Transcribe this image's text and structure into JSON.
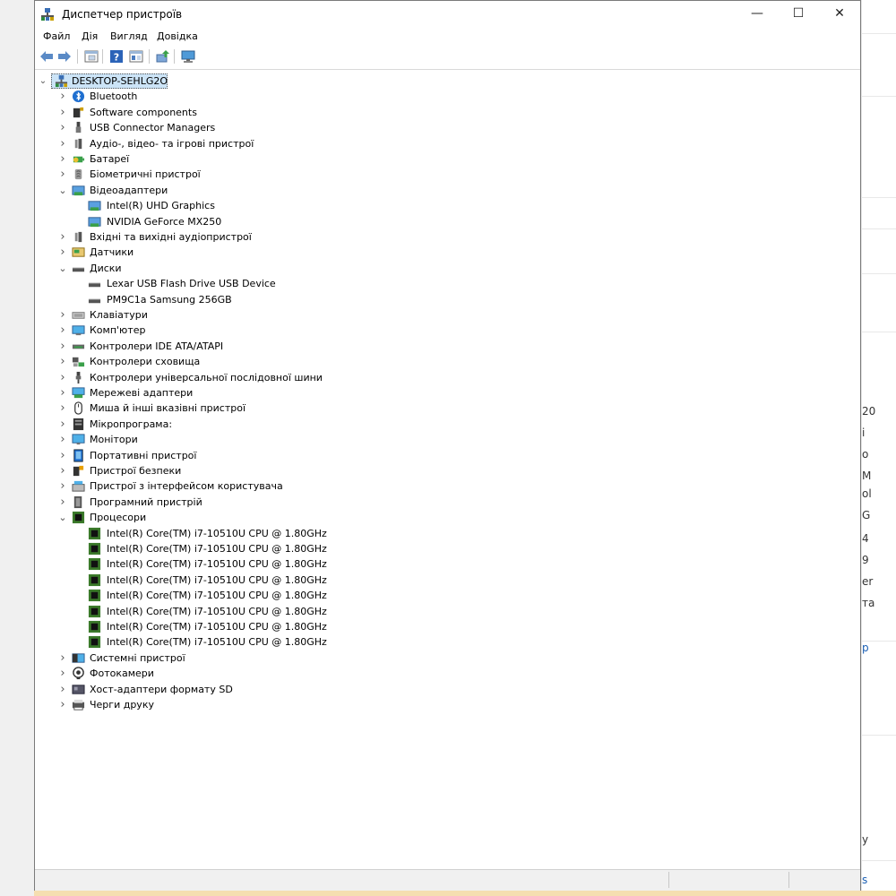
{
  "window": {
    "title": "Диспетчер пристроїв",
    "controls": {
      "minimize": "—",
      "maximize": "☐",
      "close": "✕"
    }
  },
  "menu": [
    "Файл",
    "Дія",
    "Вигляд",
    "Довідка"
  ],
  "toolbar": {
    "buttons": [
      "back-arrow-icon",
      "forward-arrow-icon",
      "properties-icon",
      "help-icon",
      "view-icon",
      "update-driver-icon",
      "scan-hardware-icon"
    ]
  },
  "tree": {
    "root": "DESKTOP-SEHLG2O",
    "nodes": [
      {
        "label": "Bluetooth",
        "icon": "bluetooth-icon",
        "expanded": false,
        "children": []
      },
      {
        "label": "Software components",
        "icon": "software-components-icon",
        "expanded": false,
        "children": []
      },
      {
        "label": "USB Connector Managers",
        "icon": "usb-connector-icon",
        "expanded": false,
        "children": []
      },
      {
        "label": "Аудіо-, відео- та ігрові пристрої",
        "icon": "speaker-icon",
        "expanded": false,
        "children": []
      },
      {
        "label": "Батареї",
        "icon": "battery-icon",
        "expanded": false,
        "children": []
      },
      {
        "label": "Біометричні пристрої",
        "icon": "fingerprint-icon",
        "expanded": false,
        "children": []
      },
      {
        "label": "Відеоадаптери",
        "icon": "display-adapter-icon",
        "expanded": true,
        "children": [
          {
            "label": "Intel(R) UHD Graphics",
            "icon": "display-adapter-icon"
          },
          {
            "label": "NVIDIA GeForce MX250",
            "icon": "display-adapter-icon"
          }
        ]
      },
      {
        "label": "Вхідні та вихідні аудіопристрої",
        "icon": "speaker-icon",
        "expanded": false,
        "children": []
      },
      {
        "label": "Датчики",
        "icon": "sensor-icon",
        "expanded": false,
        "children": []
      },
      {
        "label": "Диски",
        "icon": "disk-drive-icon",
        "expanded": true,
        "children": [
          {
            "label": "Lexar USB Flash Drive USB Device",
            "icon": "disk-drive-icon"
          },
          {
            "label": "PM9C1a Samsung 256GB",
            "icon": "disk-drive-icon"
          }
        ]
      },
      {
        "label": "Клавіатури",
        "icon": "keyboard-icon",
        "expanded": false,
        "children": []
      },
      {
        "label": "Комп'ютер",
        "icon": "computer-icon",
        "expanded": false,
        "children": []
      },
      {
        "label": "Контролери IDE ATA/ATAPI",
        "icon": "ide-controller-icon",
        "expanded": false,
        "children": []
      },
      {
        "label": "Контролери сховища",
        "icon": "storage-controller-icon",
        "expanded": false,
        "children": []
      },
      {
        "label": "Контролери універсальної послідовної шини",
        "icon": "usb-plug-icon",
        "expanded": false,
        "children": []
      },
      {
        "label": "Мережеві адаптери",
        "icon": "network-adapter-icon",
        "expanded": false,
        "children": []
      },
      {
        "label": "Миша й інші вказівні пристрої",
        "icon": "mouse-icon",
        "expanded": false,
        "children": []
      },
      {
        "label": "Мікропрограма:",
        "icon": "firmware-icon",
        "expanded": false,
        "children": []
      },
      {
        "label": "Монітори",
        "icon": "monitor-icon",
        "expanded": false,
        "children": []
      },
      {
        "label": "Портативні пристрої",
        "icon": "portable-device-icon",
        "expanded": false,
        "children": []
      },
      {
        "label": "Пристрої безпеки",
        "icon": "security-device-icon",
        "expanded": false,
        "children": []
      },
      {
        "label": "Пристрої з інтерфейсом користувача",
        "icon": "hid-icon",
        "expanded": false,
        "children": []
      },
      {
        "label": "Програмний пристрій",
        "icon": "software-device-icon",
        "expanded": false,
        "children": []
      },
      {
        "label": "Процесори",
        "icon": "processor-icon",
        "expanded": true,
        "children": [
          {
            "label": "Intel(R) Core(TM) i7-10510U CPU @ 1.80GHz",
            "icon": "processor-icon"
          },
          {
            "label": "Intel(R) Core(TM) i7-10510U CPU @ 1.80GHz",
            "icon": "processor-icon"
          },
          {
            "label": "Intel(R) Core(TM) i7-10510U CPU @ 1.80GHz",
            "icon": "processor-icon"
          },
          {
            "label": "Intel(R) Core(TM) i7-10510U CPU @ 1.80GHz",
            "icon": "processor-icon"
          },
          {
            "label": "Intel(R) Core(TM) i7-10510U CPU @ 1.80GHz",
            "icon": "processor-icon"
          },
          {
            "label": "Intel(R) Core(TM) i7-10510U CPU @ 1.80GHz",
            "icon": "processor-icon"
          },
          {
            "label": "Intel(R) Core(TM) i7-10510U CPU @ 1.80GHz",
            "icon": "processor-icon"
          },
          {
            "label": "Intel(R) Core(TM) i7-10510U CPU @ 1.80GHz",
            "icon": "processor-icon"
          }
        ]
      },
      {
        "label": "Системні пристрої",
        "icon": "system-devices-icon",
        "expanded": false,
        "children": []
      },
      {
        "label": "Фотокамери",
        "icon": "camera-icon",
        "expanded": false,
        "children": []
      },
      {
        "label": "Хост-адаптери формату SD",
        "icon": "sd-host-icon",
        "expanded": false,
        "children": []
      },
      {
        "label": "Черги друку",
        "icon": "printer-icon",
        "expanded": false,
        "children": []
      }
    ]
  },
  "background_fragments": [
    "20",
    "i",
    "o",
    "M",
    "ol",
    "G",
    "4",
    "9",
    "er",
    "та",
    "p",
    "y",
    "s"
  ]
}
